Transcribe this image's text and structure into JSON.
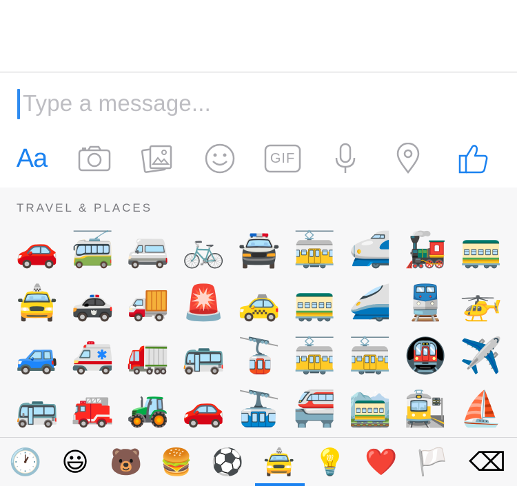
{
  "composer": {
    "placeholder": "Type a message..."
  },
  "toolbar": {
    "text_label": "Aa",
    "gif_label": "GIF",
    "items": [
      "text-format",
      "camera",
      "photo-gallery",
      "emoji",
      "gif",
      "microphone",
      "location",
      "like"
    ],
    "accent_color": "#1b82f0",
    "icon_color": "#a7a7ac"
  },
  "emoji_panel": {
    "section_title": "TRAVEL & PLACES",
    "rows": [
      [
        "🚗",
        "🚎",
        "🚐",
        "🚲",
        "🚔",
        "🚋",
        "🚅",
        "🚂",
        "🚃",
        "🚦"
      ],
      [
        "🚖",
        "🚓",
        "🚚",
        "🚨",
        "🚕",
        "🚃",
        "🚄",
        "🚆",
        "🚁",
        "🚀"
      ],
      [
        "🚙",
        "🚑",
        "🚛",
        "🚌",
        "🚡",
        "🚋",
        "🚋",
        "🚇",
        "✈️"
      ],
      [
        "🚌",
        "🚒",
        "🚜",
        "🚗",
        "🚠",
        "🚝",
        "🚞",
        "🚉",
        "⛵"
      ]
    ]
  },
  "category_tabs": {
    "items": [
      "🕐",
      "😃",
      "🐻",
      "🍔",
      "⚽",
      "🚖",
      "💡",
      "❤️",
      "🏳️",
      "⌫"
    ],
    "selected_index": 5
  }
}
